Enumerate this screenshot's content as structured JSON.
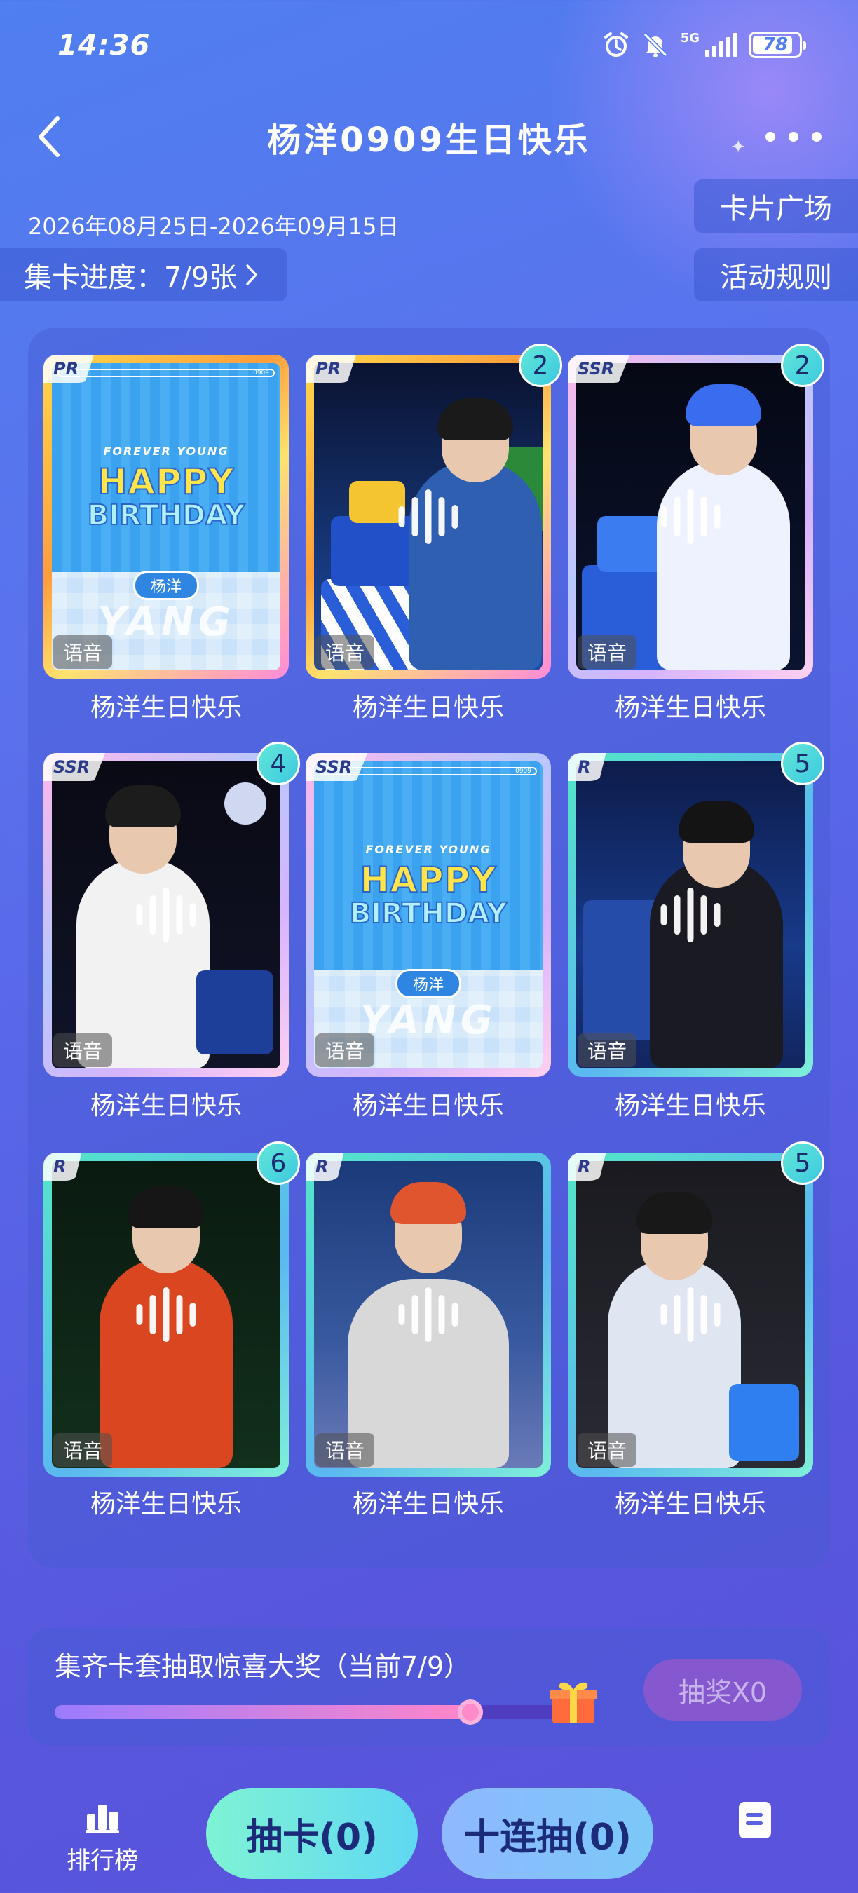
{
  "status_bar": {
    "time": "14:36",
    "network": "5G",
    "battery": "78"
  },
  "header": {
    "title": "杨洋0909生日快乐",
    "date_range": "2026年08月25日-2026年09月15日",
    "progress_label": "集卡进度：7/9张",
    "card_square_label": "卡片广场",
    "rules_label": "活动规则"
  },
  "cards": [
    {
      "rarity": "PR",
      "count": "",
      "caption": "杨洋生日快乐",
      "voice": "语音",
      "type": "birthday-design"
    },
    {
      "rarity": "PR",
      "count": "2",
      "caption": "杨洋生日快乐",
      "voice": "语音",
      "type": "photo"
    },
    {
      "rarity": "SSR",
      "count": "2",
      "caption": "杨洋生日快乐",
      "voice": "语音",
      "type": "photo"
    },
    {
      "rarity": "SSR",
      "count": "4",
      "caption": "杨洋生日快乐",
      "voice": "语音",
      "type": "photo"
    },
    {
      "rarity": "SSR",
      "count": "",
      "caption": "杨洋生日快乐",
      "voice": "语音",
      "type": "birthday-design"
    },
    {
      "rarity": "R",
      "count": "5",
      "caption": "杨洋生日快乐",
      "voice": "语音",
      "type": "photo"
    },
    {
      "rarity": "R",
      "count": "6",
      "caption": "杨洋生日快乐",
      "voice": "语音",
      "type": "photo"
    },
    {
      "rarity": "R",
      "count": "",
      "caption": "杨洋生日快乐",
      "voice": "语音",
      "type": "photo"
    },
    {
      "rarity": "R",
      "count": "5",
      "caption": "杨洋生日快乐",
      "voice": "语音",
      "type": "photo"
    }
  ],
  "birthday_design": {
    "forever_young": "FOREVER YOUNG",
    "happy": "HAPPY",
    "birthday": "BIRTHDAY",
    "name_tag": "杨洋",
    "top_code": "0909",
    "signature": "YANG"
  },
  "prize": {
    "title": "集齐卡套抽取惊喜大奖（当前7/9）",
    "progress": 0.78,
    "draw_button": "抽奖X0"
  },
  "nav": {
    "rank_label": "排行榜",
    "single_draw": "抽卡(0)",
    "ten_draw": "十连抽(0)"
  },
  "colors": {
    "accent_teal": "#62e7d8",
    "pr_gold": "#ffd84a",
    "r_frame": "#54e6c8"
  }
}
